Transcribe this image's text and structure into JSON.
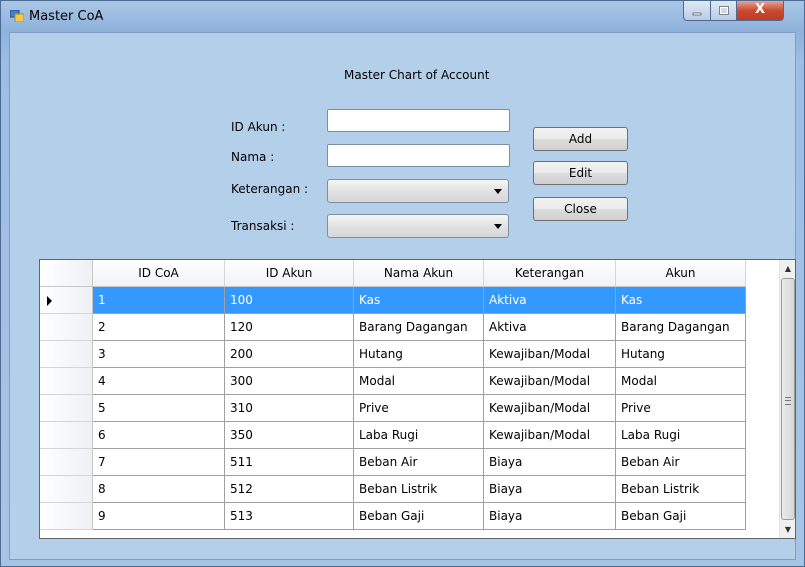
{
  "window": {
    "title": "Master CoA",
    "close_glyph": "X"
  },
  "form": {
    "heading": "Master Chart of Account",
    "labels": {
      "id_akun": "ID Akun :",
      "nama": "Nama :",
      "keterangan": "Keterangan :",
      "transaksi": "Transaksi :"
    },
    "values": {
      "id_akun": "",
      "nama": "",
      "keterangan": "",
      "transaksi": ""
    },
    "buttons": {
      "add": "Add",
      "edit": "Edit",
      "close": "Close"
    }
  },
  "grid": {
    "columns": [
      "ID CoA",
      "ID Akun",
      "Nama Akun",
      "Keterangan",
      "Akun"
    ],
    "rows": [
      [
        "1",
        "100",
        "Kas",
        "Aktiva",
        "Kas"
      ],
      [
        "2",
        "120",
        "Barang Dagangan",
        "Aktiva",
        "Barang Dagangan"
      ],
      [
        "3",
        "200",
        "Hutang",
        "Kewajiban/Modal",
        "Hutang"
      ],
      [
        "4",
        "300",
        "Modal",
        "Kewajiban/Modal",
        "Modal"
      ],
      [
        "5",
        "310",
        "Prive",
        "Kewajiban/Modal",
        "Prive"
      ],
      [
        "6",
        "350",
        "Laba Rugi",
        "Kewajiban/Modal",
        "Laba Rugi"
      ],
      [
        "7",
        "511",
        "Beban Air",
        "Biaya",
        "Beban Air"
      ],
      [
        "8",
        "512",
        "Beban Listrik",
        "Biaya",
        "Beban Listrik"
      ],
      [
        "9",
        "513",
        "Beban Gaji",
        "Biaya",
        "Beban Gaji"
      ]
    ],
    "selected_row": 0
  },
  "icons": {
    "app": "form-icon",
    "minimize": "minimize-icon",
    "maximize": "maximize-icon",
    "close": "close-icon"
  },
  "colors": {
    "selection": "#3399ff",
    "titlebar": "#9dbde3",
    "client": "#b4cfe9"
  }
}
